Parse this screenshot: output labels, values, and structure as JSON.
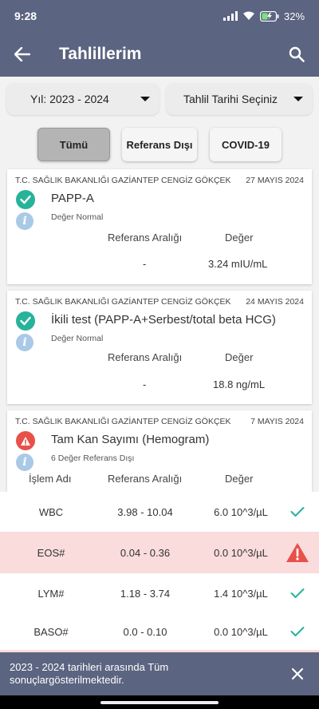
{
  "status_bar": {
    "time": "9:28",
    "battery": "32"
  },
  "app_bar": {
    "title": "Tahlillerim"
  },
  "filters": {
    "year": "Yıl: 2023 - 2024",
    "date": "Tahlil Tarihi Seçiniz"
  },
  "tabs": {
    "all": "Tümü",
    "out_of_range": "Referans Dışı",
    "covid": "COVID-19"
  },
  "cards": [
    {
      "institution": "T.C. SAĞLIK BAKANLIĞI GAZİANTEP CENGİZ GÖKÇEK",
      "date": "27 MAYIS 2024",
      "test_name": "PAPP-A",
      "status_text": "Değer Normal",
      "ref_header": "Referans Aralığı",
      "value_header": "Değer",
      "ref": "-",
      "value": "3.24 mIU/mL"
    },
    {
      "institution": "T.C. SAĞLIK BAKANLIĞI GAZİANTEP CENGİZ GÖKÇEK",
      "date": "24 MAYIS 2024",
      "test_name": "İkili test (PAPP-A+Serbest/total beta HCG)",
      "status_text": "Değer Normal",
      "ref_header": "Referans Aralığı",
      "value_header": "Değer",
      "ref": "-",
      "value": "18.8 ng/mL"
    },
    {
      "institution": "T.C. SAĞLIK BAKANLIĞI GAZİANTEP CENGİZ GÖKÇEK",
      "date": "7 MAYIS 2024",
      "test_name": "Tam Kan Sayımı (Hemogram)",
      "status_text": "6 Değer Referans Dışı",
      "name_header": "İşlem Adı",
      "ref_header": "Referans Aralığı",
      "value_header": "Değer"
    }
  ],
  "hemogram_rows": [
    {
      "name": "WBC",
      "ref": "3.98 - 10.04",
      "value": "6.0 10^3/µL",
      "status": "normal"
    },
    {
      "name": "EOS#",
      "ref": "0.04 - 0.36",
      "value": "0.0 10^3/µL",
      "status": "abnormal"
    },
    {
      "name": "LYM#",
      "ref": "1.18 - 3.74",
      "value": "1.4 10^3/µL",
      "status": "normal"
    },
    {
      "name": "BASO#",
      "ref": "0.0 - 0.10",
      "value": "0.0 10^3/µL",
      "status": "normal"
    }
  ],
  "snackbar": {
    "message": "2023 - 2024 tarihleri arasında Tüm sonuçlargösterilmektedir."
  },
  "colors": {
    "primary": "#5b6480",
    "ok": "#26b39a",
    "warn": "#e8504a",
    "info": "#a9c9e6",
    "abnormal_row": "#f9dcdb"
  },
  "icons": {
    "back": "arrow-left-icon",
    "search": "search-icon",
    "ok": "check-circle-icon",
    "warn": "warning-triangle-icon",
    "info": "info-icon",
    "close": "close-icon"
  }
}
